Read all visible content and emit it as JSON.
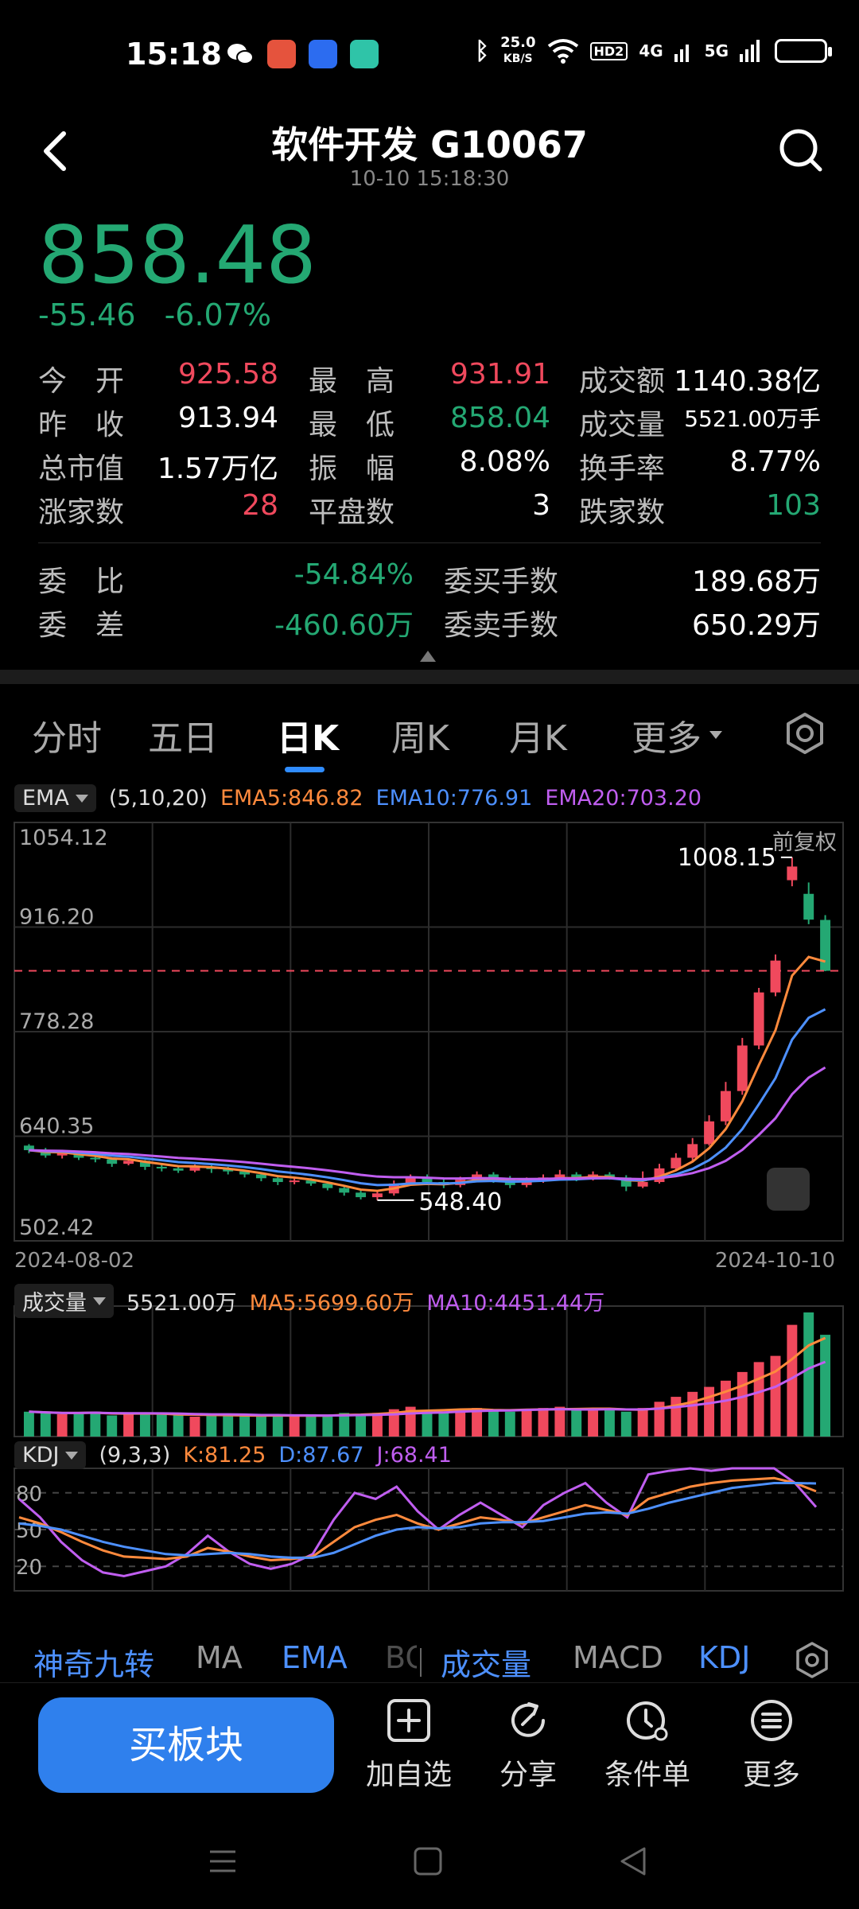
{
  "status": {
    "time": "15:18",
    "net_speed_value": "25.0",
    "net_speed_unit": "KB/S",
    "hd_badge": "HD2",
    "net1": "4G",
    "net2": "5G"
  },
  "header": {
    "title": "软件开发 G10067",
    "timestamp": "10-10 15:18:30"
  },
  "quote": {
    "price": "858.48",
    "change": "-55.46",
    "change_pct": "-6.07%"
  },
  "stats": [
    [
      {
        "label": "今　开",
        "value": "925.58"
      },
      {
        "label": "最　高",
        "value": "931.91"
      },
      {
        "label": "成交额",
        "value": "1140.38亿"
      }
    ],
    [
      {
        "label": "昨　收",
        "value": "913.94"
      },
      {
        "label": "最　低",
        "value": "858.04"
      },
      {
        "label": "成交量",
        "value": "5521.00万手"
      }
    ],
    [
      {
        "label": "总市值",
        "value": "1.57万亿"
      },
      {
        "label": "振　幅",
        "value": "8.08%"
      },
      {
        "label": "换手率",
        "value": "8.77%"
      }
    ],
    [
      {
        "label": "涨家数",
        "value": "28"
      },
      {
        "label": "平盘数",
        "value": "3"
      },
      {
        "label": "跌家数",
        "value": "103"
      }
    ]
  ],
  "orders": [
    [
      {
        "label": "委　比",
        "value": "-54.84%"
      },
      {
        "label": "委买手数",
        "value": "189.68万"
      }
    ],
    [
      {
        "label": "委　差",
        "value": "-460.60万"
      },
      {
        "label": "委卖手数",
        "value": "650.29万"
      }
    ]
  ],
  "tabs": [
    "分时",
    "五日",
    "日K",
    "周K",
    "月K",
    "更多"
  ],
  "main_legend": {
    "indicator": "EMA",
    "params": "(5,10,20)",
    "ema5": "EMA5:846.82",
    "ema10": "EMA10:776.91",
    "ema20": "EMA20:703.20"
  },
  "vol_legend": {
    "indicator": "成交量",
    "value": "5521.00万",
    "ma5": "MA5:5699.60万",
    "ma10": "MA10:4451.44万"
  },
  "kdj_legend": {
    "indicator": "KDJ",
    "params": "(9,3,3)",
    "k": "K:81.25",
    "d": "D:87.67",
    "j": "J:68.41"
  },
  "chart_data": {
    "type": "candlestick",
    "y_ticks": [
      "1054.12",
      "916.20",
      "778.28",
      "640.35",
      "502.42"
    ],
    "ylim": [
      502.42,
      1054.12
    ],
    "x_start": "2024-08-02",
    "x_end": "2024-10-10",
    "annotations": {
      "high": "1008.15",
      "low": "548.40",
      "adjust": "前复权"
    },
    "reference_price": 858.48,
    "candles": [
      [
        628,
        622,
        630,
        618
      ],
      [
        622,
        615,
        625,
        612
      ],
      [
        615,
        618,
        621,
        611
      ],
      [
        618,
        612,
        620,
        609
      ],
      [
        612,
        610,
        616,
        606
      ],
      [
        610,
        604,
        612,
        600
      ],
      [
        604,
        608,
        611,
        602
      ],
      [
        608,
        600,
        609,
        596
      ],
      [
        600,
        598,
        604,
        594
      ],
      [
        598,
        595,
        601,
        592
      ],
      [
        595,
        600,
        603,
        593
      ],
      [
        600,
        597,
        602,
        592
      ],
      [
        597,
        594,
        600,
        590
      ],
      [
        594,
        590,
        596,
        586
      ],
      [
        590,
        585,
        592,
        581
      ],
      [
        585,
        580,
        588,
        576
      ],
      [
        580,
        582,
        586,
        577
      ],
      [
        582,
        578,
        585,
        575
      ],
      [
        578,
        572,
        580,
        569
      ],
      [
        572,
        566,
        574,
        562
      ],
      [
        566,
        560,
        569,
        557
      ],
      [
        560,
        565,
        569,
        556
      ],
      [
        565,
        578,
        582,
        562
      ],
      [
        578,
        586,
        590,
        575
      ],
      [
        586,
        580,
        590,
        576
      ],
      [
        580,
        576,
        584,
        572
      ],
      [
        576,
        583,
        587,
        573
      ],
      [
        583,
        590,
        594,
        580
      ],
      [
        590,
        584,
        593,
        579
      ],
      [
        584,
        576,
        588,
        572
      ],
      [
        576,
        582,
        586,
        573
      ],
      [
        582,
        586,
        590,
        579
      ],
      [
        586,
        590,
        596,
        583
      ],
      [
        590,
        585,
        593,
        581
      ],
      [
        585,
        590,
        594,
        582
      ],
      [
        590,
        586,
        593,
        583
      ],
      [
        586,
        574,
        589,
        568
      ],
      [
        574,
        580,
        594,
        572
      ],
      [
        580,
        598,
        604,
        578
      ],
      [
        598,
        612,
        618,
        596
      ],
      [
        612,
        630,
        638,
        608
      ],
      [
        630,
        660,
        668,
        628
      ],
      [
        660,
        700,
        712,
        655
      ],
      [
        700,
        760,
        770,
        695
      ],
      [
        760,
        830,
        836,
        755
      ],
      [
        830,
        872,
        880,
        825
      ],
      [
        978,
        996,
        1008.15,
        970
      ],
      [
        960,
        926,
        975,
        920
      ],
      [
        925.58,
        858.48,
        931.91,
        858.04
      ]
    ],
    "volume": [
      20,
      19,
      18,
      19,
      20,
      17,
      18,
      19,
      18,
      17,
      16,
      17,
      18,
      17,
      16,
      17,
      16,
      18,
      17,
      19,
      18,
      19,
      22,
      24,
      21,
      20,
      22,
      23,
      21,
      20,
      22,
      23,
      24,
      22,
      21,
      22,
      20,
      23,
      28,
      32,
      36,
      40,
      45,
      52,
      60,
      65,
      90,
      100,
      82
    ],
    "kdj": {
      "K": [
        60,
        55,
        48,
        40,
        33,
        28,
        27,
        26,
        28,
        35,
        32,
        28,
        25,
        26,
        28,
        40,
        52,
        58,
        62,
        55,
        50,
        55,
        60,
        58,
        55,
        60,
        65,
        70,
        66,
        62,
        75,
        80,
        85,
        88,
        90,
        91,
        92,
        88,
        81.25
      ],
      "D": [
        55,
        53,
        50,
        45,
        40,
        36,
        33,
        30,
        29,
        30,
        31,
        30,
        28,
        27,
        27,
        31,
        38,
        45,
        50,
        52,
        51,
        52,
        55,
        56,
        56,
        57,
        60,
        63,
        64,
        63,
        67,
        72,
        76,
        80,
        84,
        86,
        88,
        88,
        87.67
      ],
      "J": [
        75,
        60,
        40,
        25,
        15,
        12,
        16,
        20,
        30,
        45,
        32,
        22,
        18,
        22,
        30,
        58,
        80,
        75,
        85,
        65,
        50,
        62,
        72,
        62,
        52,
        70,
        80,
        88,
        72,
        60,
        95,
        98,
        100,
        98,
        100,
        100,
        100,
        88,
        68.41
      ]
    }
  },
  "indicators": [
    "神奇九转",
    "MA",
    "EMA",
    "BO",
    "成交量",
    "MACD",
    "KDJ"
  ],
  "bottom": {
    "buy": "买板块",
    "actions": [
      "加自选",
      "分享",
      "条件单",
      "更多"
    ]
  }
}
